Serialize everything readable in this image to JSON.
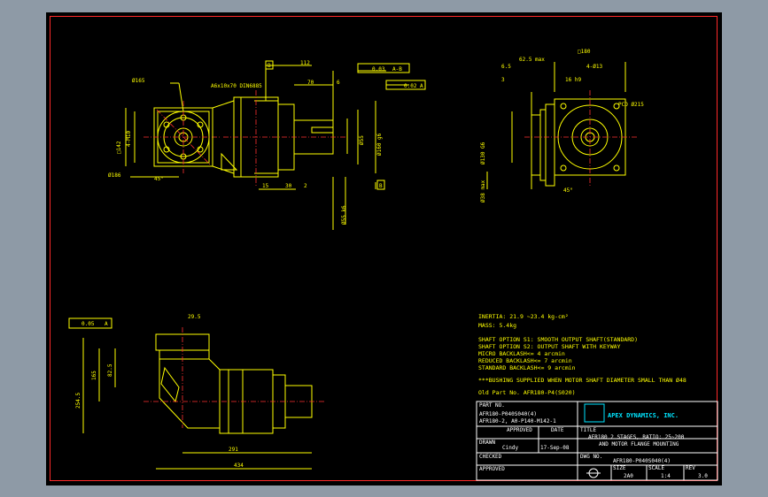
{
  "drawing": {
    "notes": {
      "inertia": "INERTIA:   21.9 ~23.4 kg-cm²",
      "mass": "MASS:  5.4kg",
      "shaft_s1": "SHAFT OPTION S1: SMOOTH OUTPUT SHAFT(STANDARD)",
      "shaft_s2": "SHAFT OPTION S2: OUTPUT SHAFT WITH KEYWAY",
      "micro": "MICRO BACKLASH<= 4 arcmin",
      "reduced": "REDUCED BACKLASH<= 7 arcmin",
      "standard": "STANDARD BACKLASH<= 9 arcmin",
      "bushing": "***BUSHING SUPPLIED WHEN MOTOR SHAFT DIAMETER SMALL THAN Ø48",
      "old_part": "Old Part No. AFR180-P4(S020)"
    },
    "dimensions": {
      "d165": "Ø165",
      "key": "A6x10x70 DIN6885",
      "d112": "112",
      "d70": "70",
      "d6": "6",
      "tol_03": "0.03",
      "tol_ab": "A-B",
      "tol_02": "0.02",
      "datum_a": "A",
      "datum_b": "B",
      "sq142": "□142",
      "m10": "4-M10",
      "d186": "Ø186",
      "ang45": "45°",
      "d55": "Ø55",
      "d160": "Ø160 g6",
      "d15": "15",
      "d30": "30",
      "d2": "2",
      "d55k6": "Ø55 k6",
      "d625": "62.5 max",
      "sq180": "□180",
      "d65": "6.5",
      "d4x13": "4-Ø13",
      "d3": "3",
      "h16": "16 h9",
      "pcd": "PCD Ø215",
      "d130": "Ø130 G6",
      "d38": "Ø38 max",
      "ang45b": "45°",
      "t005": "0.05",
      "d295": "29.5",
      "d165b": "165",
      "d825": "82.5",
      "d2545": "254.5",
      "d291": "291",
      "d434": "434"
    },
    "title_block": {
      "part_no_label": "PART NO.",
      "part_no_1": "AFR180-P040S040(4)",
      "part_no_2": "AFR180-2, A0-P140-M142-1",
      "company": "APEX DYNAMICS, INC.",
      "approved_label": "APPROVED",
      "date_label": "DATE",
      "drawn_label": "DRAWN",
      "drawn_by": "Cindy",
      "date": "17-Sep-08",
      "checked_label": "CHECKED",
      "approved2_label": "APPROVED",
      "title_label": "TITLE",
      "title_1": "AFR180 2 STAGES, RATIO: 25~200",
      "title_2": "AND MOTOR FLANGE MOUNTING",
      "dwg_label": "DWG NO.",
      "dwg_no": "AFR180-P040S040(4)",
      "size_label": "SIZE",
      "size": "2A0",
      "scale_label": "SCALE",
      "scale": "1:4",
      "rev_label": "REV",
      "rev": "3.0"
    }
  }
}
